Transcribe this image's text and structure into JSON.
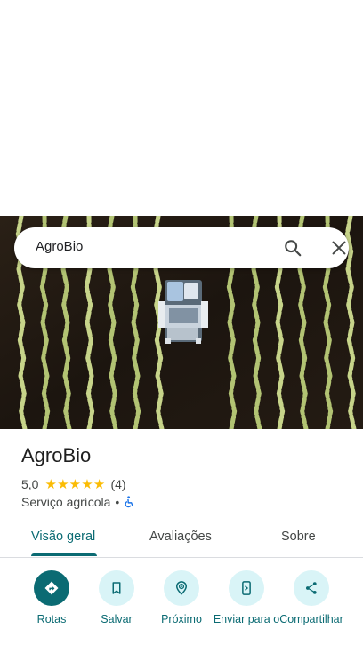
{
  "search": {
    "query": "AgroBio"
  },
  "place": {
    "name": "AgroBio",
    "rating": "5,0",
    "stars": 5,
    "review_count": "(4)",
    "category": "Serviço agrícola",
    "separator": "•"
  },
  "tabs": [
    {
      "label": "Visão geral",
      "active": true
    },
    {
      "label": "Avaliações",
      "active": false
    },
    {
      "label": "Sobre",
      "active": false
    }
  ],
  "actions": [
    {
      "label": "Rotas",
      "icon": "directions-icon",
      "primary": true
    },
    {
      "label": "Salvar",
      "icon": "bookmark-icon",
      "primary": false
    },
    {
      "label": "Próximo",
      "icon": "nearby-icon",
      "primary": false
    },
    {
      "label": "Enviar para o",
      "icon": "send-to-phone-icon",
      "primary": false
    },
    {
      "label": "Compartilhar",
      "icon": "share-icon",
      "primary": false
    }
  ],
  "colors": {
    "accent": "#0b6b73",
    "accent_light": "#d9f4f7",
    "star": "#fbbc04",
    "text_secondary": "#444746"
  }
}
